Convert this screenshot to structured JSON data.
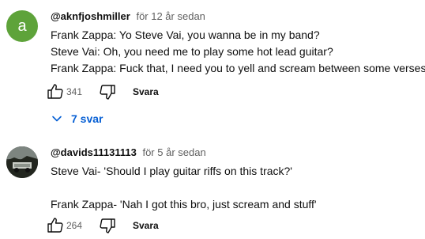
{
  "comments": [
    {
      "avatar_letter": "a",
      "avatar_color": "#5ea33a",
      "author": "@aknfjoshmiller",
      "time": "för 12 år sedan",
      "lines": [
        "Frank Zappa: Yo Steve Vai, you wanna be in my band?",
        "Steve Vai: Oh, you need me to play some hot lead guitar?",
        "Frank Zappa: Fuck that, I need you to yell and scream between some verses."
      ],
      "likes": "341",
      "reply_label": "Svara",
      "replies_label": "7 svar"
    },
    {
      "author": "@davids11131113",
      "time": "för 5 år sedan",
      "lines": [
        "Steve Vai- 'Should I play guitar riffs on this track?'",
        "",
        "Frank Zappa- 'Nah I got this bro, just scream and stuff'"
      ],
      "likes": "264",
      "reply_label": "Svara"
    }
  ],
  "colors": {
    "link_blue": "#065fd4",
    "meta_gray": "#606060"
  },
  "icons": [
    "like-icon",
    "dislike-icon",
    "chevron-down-icon"
  ]
}
